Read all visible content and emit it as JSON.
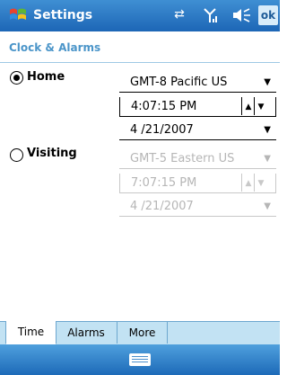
{
  "titlebar": {
    "title": "Settings",
    "ok_label": "ok"
  },
  "page": {
    "header": "Clock & Alarms"
  },
  "home": {
    "label": "Home",
    "selected": true,
    "timezone": "GMT-8 Pacific US",
    "time": "4:07:15 PM",
    "date": "4 /21/2007"
  },
  "visiting": {
    "label": "Visiting",
    "selected": false,
    "timezone": "GMT-5 Eastern US",
    "time": "7:07:15 PM",
    "date": "4 /21/2007"
  },
  "tabs": [
    {
      "label": "Time",
      "active": true
    },
    {
      "label": "Alarms",
      "active": false
    },
    {
      "label": "More",
      "active": false
    }
  ],
  "icons": {
    "start": "windows-flag-icon",
    "connectivity": "connectivity-arrows-icon",
    "signal": "signal-strength-icon",
    "volume": "volume-icon",
    "keyboard": "keyboard-icon"
  },
  "colors": {
    "titlebar": "#1d66b6",
    "header_text": "#4b95c9",
    "tabbar": "#c2e2f3"
  }
}
